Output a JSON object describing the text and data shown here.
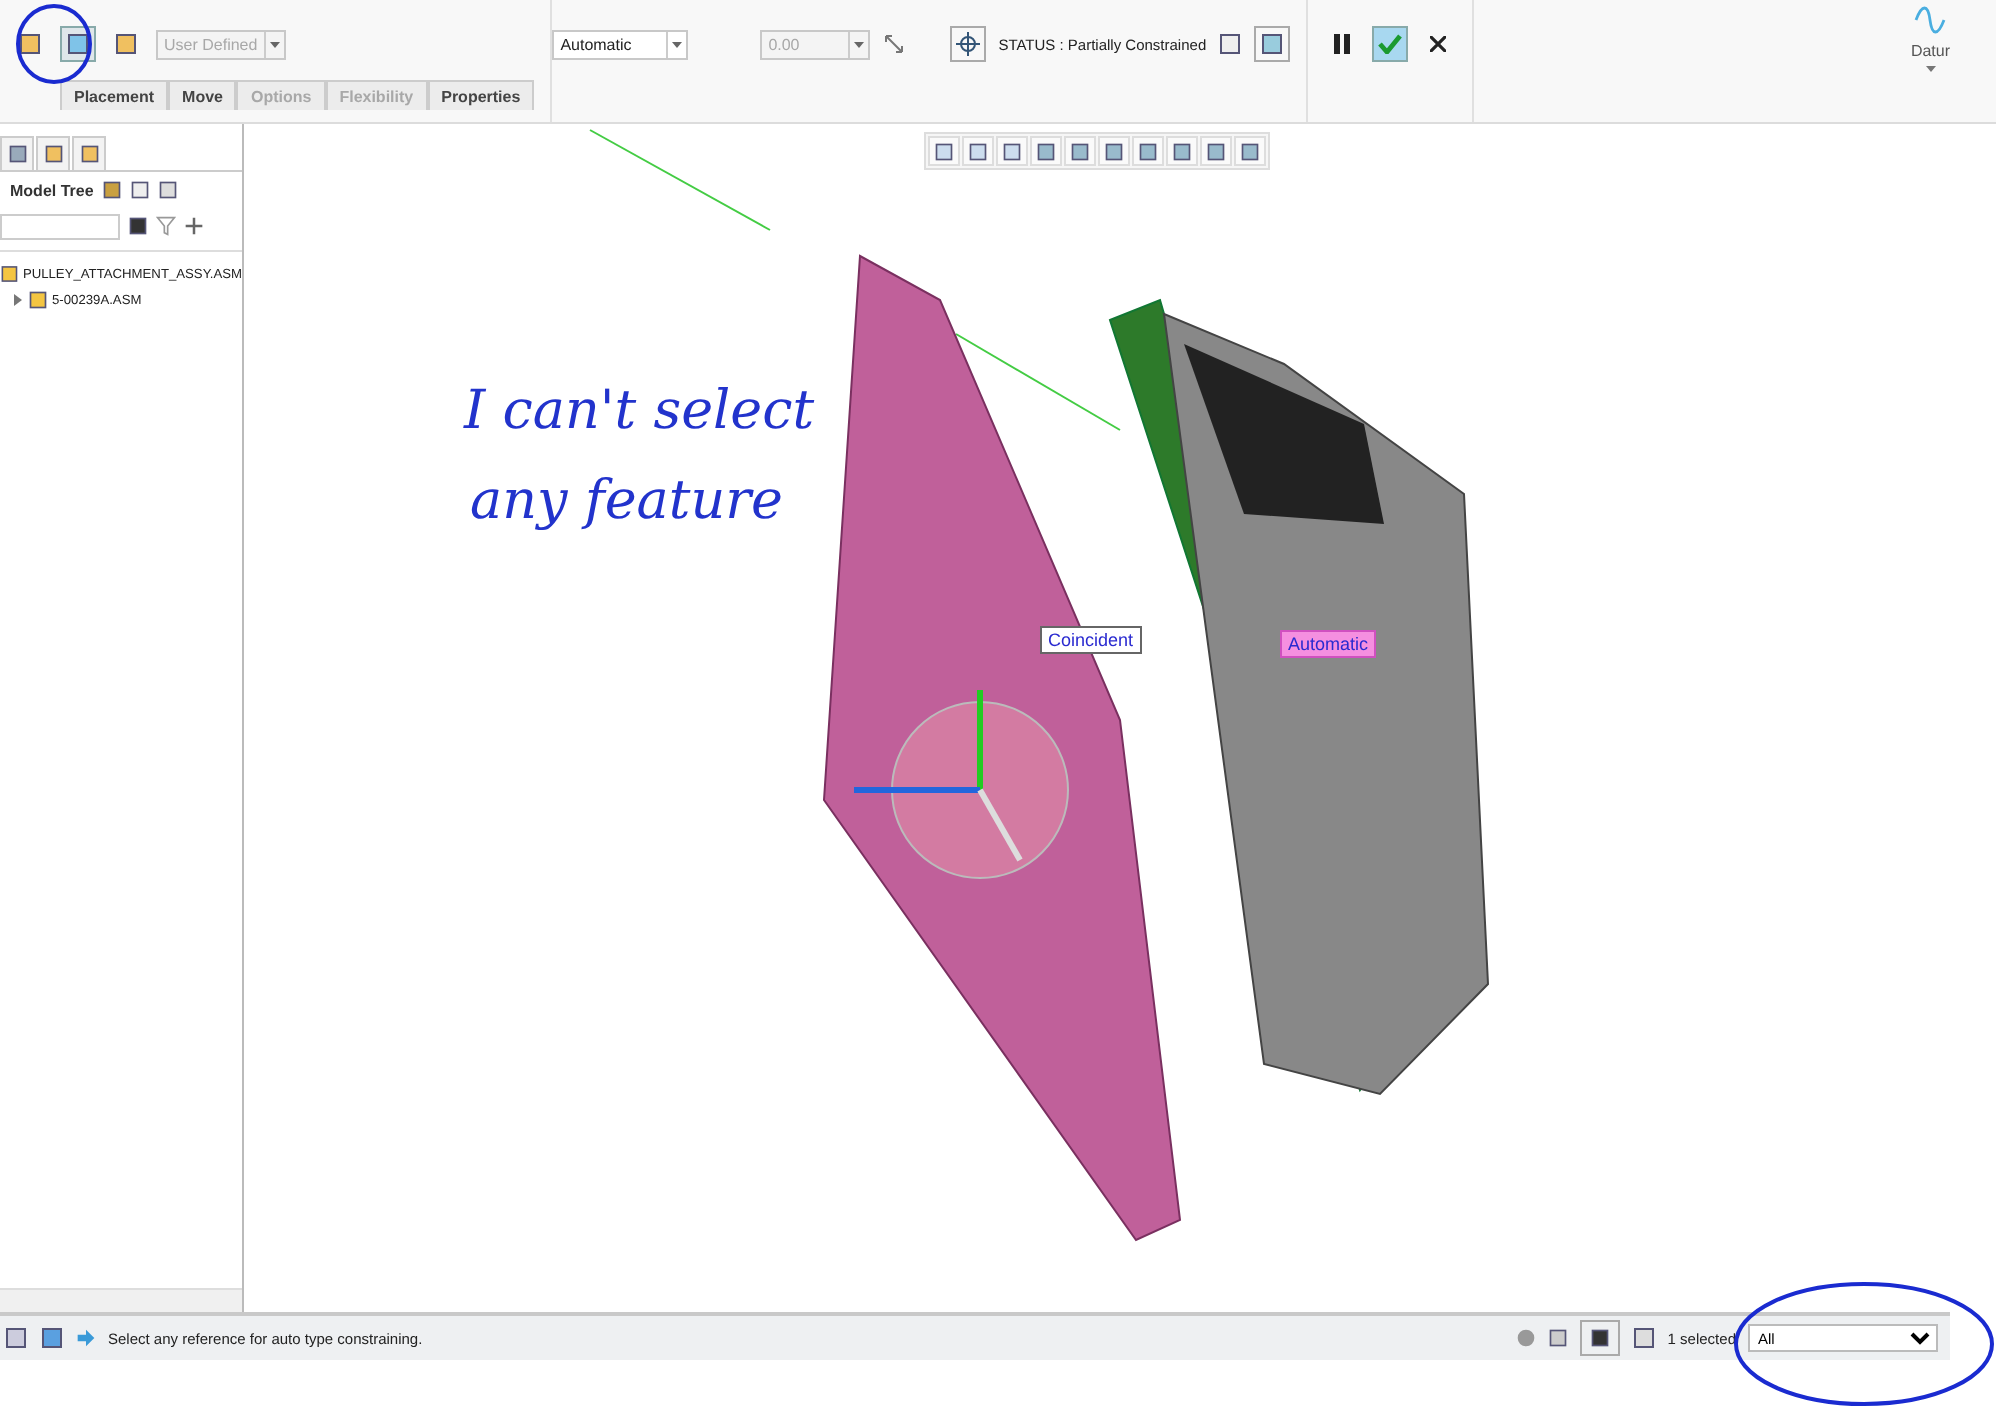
{
  "ribbon": {
    "mode_buttons": [
      {
        "selected": false
      },
      {
        "selected": true
      },
      {
        "selected": false
      }
    ],
    "constraint_type": {
      "value": "User Defined",
      "disabled": true
    },
    "constraint_mode": {
      "value": "Automatic",
      "disabled": false
    },
    "offset": {
      "value": "0.00",
      "disabled": true
    },
    "status": "STATUS : Partially Constrained",
    "tabs": [
      {
        "label": "Placement",
        "disabled": false
      },
      {
        "label": "Move",
        "disabled": false
      },
      {
        "label": "Options",
        "disabled": true
      },
      {
        "label": "Flexibility",
        "disabled": true
      },
      {
        "label": "Properties",
        "disabled": false
      }
    ],
    "datum": {
      "label": "Datur"
    }
  },
  "model_tree": {
    "title": "Model Tree",
    "items": [
      {
        "label": "PULLEY_ATTACHMENT_ASSY.ASM",
        "children": [
          {
            "label": "5-00239A.ASM",
            "expanded": false
          }
        ]
      }
    ]
  },
  "canvas": {
    "callouts": [
      {
        "label": "Coincident",
        "kind": "boxed"
      },
      {
        "label": "Automatic",
        "kind": "highlighted"
      }
    ],
    "annotation": [
      "I can't select",
      "any feature"
    ]
  },
  "status_bar": {
    "message": "Select any reference for auto type constraining.",
    "selection_count": "1 selected",
    "filter": "All"
  }
}
